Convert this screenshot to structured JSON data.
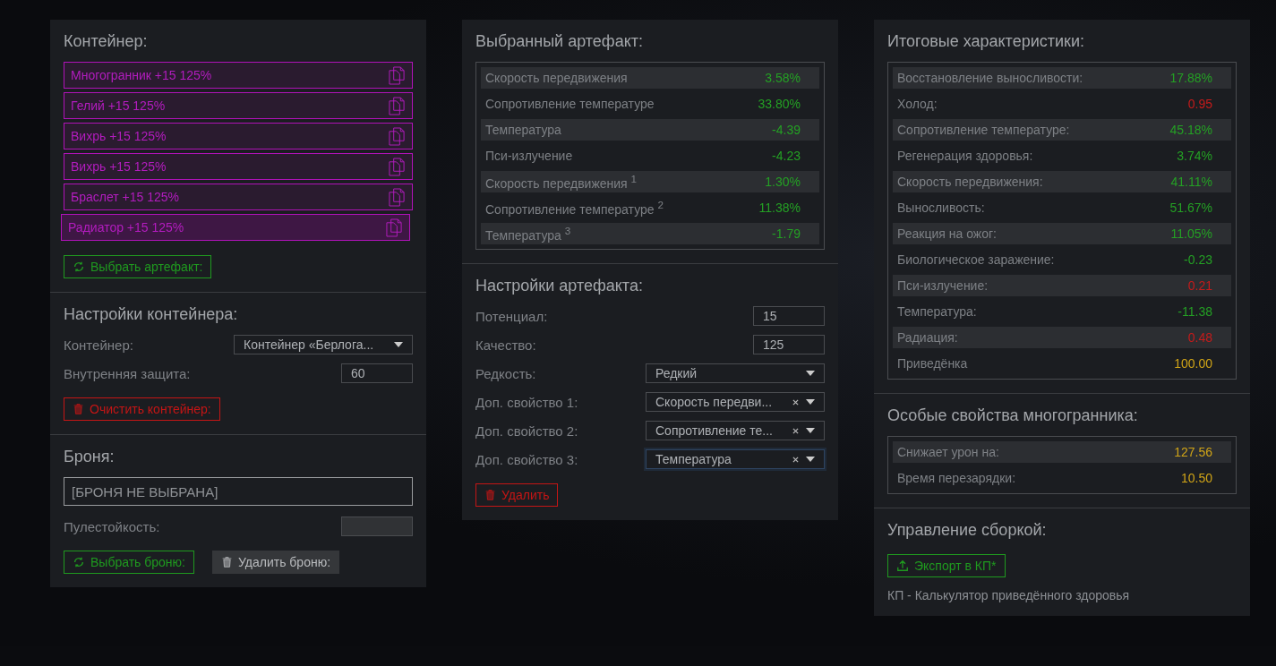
{
  "container_panel": {
    "title": "Контейнер:",
    "items": [
      {
        "label": "Многогранник +15 125%",
        "selected": false
      },
      {
        "label": "Гелий +15 125%",
        "selected": false
      },
      {
        "label": "Вихрь +15 125%",
        "selected": false
      },
      {
        "label": "Вихрь +15 125%",
        "selected": false
      },
      {
        "label": "Браслет +15 125%",
        "selected": false
      },
      {
        "label": "Радиатор +15 125%",
        "selected": true
      }
    ],
    "button": {
      "label": "Выбрать артефакт:",
      "kind": "select"
    }
  },
  "container_settings": {
    "title": "Настройки контейнера:",
    "fields": [
      {
        "kind": "select",
        "label": "Контейнер:",
        "value": "Контейнер «Берлога...",
        "clearable": false,
        "focused": false
      },
      {
        "kind": "input",
        "label": "Внутренняя защита:",
        "value": "60",
        "disabled": false
      }
    ],
    "button": {
      "label": "Очистить контейнер:",
      "kind": "delete"
    }
  },
  "armor": {
    "title": "Броня:",
    "value": "[БРОНЯ НЕ ВЫБРАНА]",
    "fields": [
      {
        "kind": "input",
        "label": "Пулестойкость:",
        "disabled": true
      }
    ],
    "buttons": [
      {
        "label": "Выбрать броню:",
        "kind": "select"
      },
      {
        "label": "Удалить броню:",
        "kind": "neutral"
      }
    ]
  },
  "selected_artifact": {
    "title": "Выбранный артефакт:",
    "stats": [
      {
        "name": "Скорость передвижения",
        "value": "3.58%",
        "kind": "positive"
      },
      {
        "name": "Сопротивление температуре",
        "value": "33.80%",
        "kind": "positive"
      },
      {
        "name": "Температура",
        "value": "-4.39",
        "kind": "positive"
      },
      {
        "name": "Пси-излучение",
        "value": "-4.23",
        "kind": "positive"
      },
      {
        "name": "Скорость передвижения $^{1}$",
        "value": "1.30%",
        "kind": "positive"
      },
      {
        "name": "Сопротивление температуре $^{2}$",
        "value": "11.38%",
        "kind": "positive"
      },
      {
        "name": "Температура $^{3}$",
        "value": "-1.79",
        "kind": "positive"
      }
    ]
  },
  "artifact_settings": {
    "title": "Настройки артефакта:",
    "fields": [
      {
        "kind": "input",
        "label": "Потенциал:",
        "value": "15",
        "disabled": false
      },
      {
        "kind": "input",
        "label": "Качество:",
        "value": "125",
        "disabled": false
      },
      {
        "kind": "select",
        "label": "Редкость:",
        "value": "Редкий",
        "clearable": false,
        "focused": false
      },
      {
        "kind": "select",
        "label": "Доп. свойство 1:",
        "value": "Скорость передви...",
        "clearable": true,
        "focused": false
      },
      {
        "kind": "select",
        "label": "Доп. свойство 2:",
        "value": "Сопротивление те...",
        "clearable": true,
        "focused": false
      },
      {
        "kind": "select",
        "label": "Доп. свойство 3:",
        "value": "Температура",
        "clearable": true,
        "focused": true
      }
    ],
    "button": {
      "label": "Удалить",
      "kind": "delete"
    }
  },
  "totals": {
    "title": "Итоговые характеристики:",
    "stats": [
      {
        "name": "Восстановление выносливости:",
        "value": "17.88%",
        "kind": "positive"
      },
      {
        "name": "Холод:",
        "value": "0.95",
        "kind": "negative"
      },
      {
        "name": "Сопротивление температуре:",
        "value": "45.18%",
        "kind": "positive"
      },
      {
        "name": "Регенерация здоровья:",
        "value": "3.74%",
        "kind": "positive"
      },
      {
        "name": "Скорость передвижения:",
        "value": "41.11%",
        "kind": "positive"
      },
      {
        "name": "Выносливость:",
        "value": "51.67%",
        "kind": "positive"
      },
      {
        "name": "Реакция на ожог:",
        "value": "11.05%",
        "kind": "positive"
      },
      {
        "name": "Биологическое заражение:",
        "value": "-0.23",
        "kind": "positive"
      },
      {
        "name": "Пси-излучение:",
        "value": "0.21",
        "kind": "negative"
      },
      {
        "name": "Температура:",
        "value": "-11.38",
        "kind": "positive"
      },
      {
        "name": "Радиация:",
        "value": "0.48",
        "kind": "negative"
      },
      {
        "name": "Приведёнка",
        "value": "100.00",
        "kind": "special"
      }
    ]
  },
  "special": {
    "title": "Особые свойства многогранника:",
    "stats": [
      {
        "name": "Снижает урон на:",
        "value": "127.56",
        "kind": "special"
      },
      {
        "name": "Время перезарядки:",
        "value": "10.50",
        "kind": "special"
      }
    ]
  },
  "build": {
    "title": "Управление сборкой:",
    "button": {
      "label": "Экспорт в КП*",
      "kind": "export"
    },
    "note": "КП - Калькулятор приведённого здоровья"
  }
}
